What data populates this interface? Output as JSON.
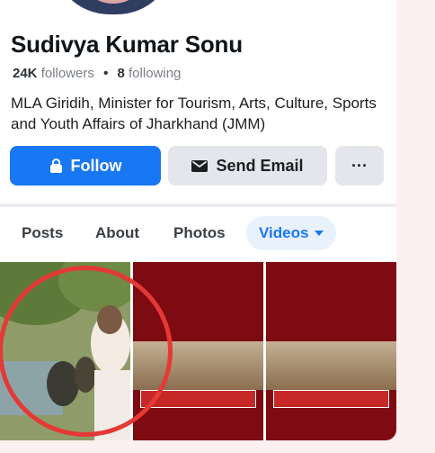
{
  "profile": {
    "name": "Sudivya Kumar Sonu",
    "followers_count": "24K",
    "followers_label": "followers",
    "following_count": "8",
    "following_label": "following",
    "separator": "•",
    "bio": "MLA Giridih, Minister for Tourism, Arts, Culture, Sports and Youth Affairs of Jharkhand (JMM)"
  },
  "actions": {
    "follow_label": "Follow",
    "email_label": "Send Email",
    "more_label": "···"
  },
  "tabs": {
    "posts": "Posts",
    "about": "About",
    "photos": "Photos",
    "videos": "Videos"
  },
  "colors": {
    "accent": "#1877f2",
    "highlight_ring": "#e53935"
  },
  "icons": {
    "follow": "follow-icon",
    "email": "envelope-icon",
    "caret": "caret-down-icon"
  }
}
